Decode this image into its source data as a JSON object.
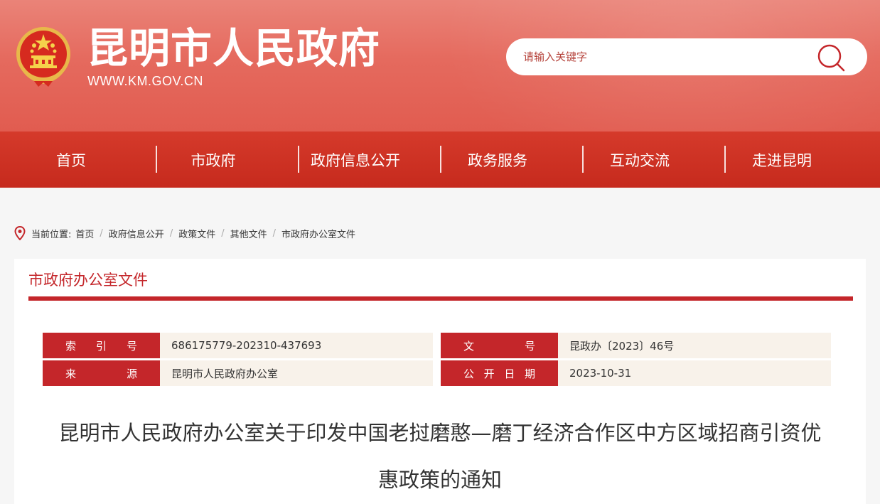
{
  "header": {
    "title": "昆明市人民政府",
    "url": "WWW.KM.GOV.CN",
    "search_placeholder": "请输入关键字"
  },
  "nav": {
    "items": [
      {
        "label": "首页"
      },
      {
        "label": "市政府"
      },
      {
        "label": "政府信息公开"
      },
      {
        "label": "政务服务"
      },
      {
        "label": "互动交流"
      },
      {
        "label": "走进昆明"
      }
    ]
  },
  "breadcrumb": {
    "prefix": "当前位置:",
    "items": [
      "首页",
      "政府信息公开",
      "政策文件",
      "其他文件",
      "市政府办公室文件"
    ]
  },
  "panel": {
    "title": "市政府办公室文件"
  },
  "meta": {
    "index_label": [
      "索",
      "引",
      "号"
    ],
    "index_value": "686175779-202310-437693",
    "docno_label": [
      "文",
      "号"
    ],
    "docno_value": "昆政办〔2023〕46号",
    "source_label": [
      "来",
      "源"
    ],
    "source_value": "昆明市人民政府办公室",
    "date_label": [
      "公",
      "开",
      "日",
      "期"
    ],
    "date_value": "2023-10-31"
  },
  "document": {
    "title_line1": "昆明市人民政府办公室关于印发中国老挝磨憨—磨丁经济合作区中方区域招商引资优",
    "title_line2": "惠政策的通知"
  },
  "colors": {
    "header_top": "#ea8378",
    "nav_red": "#c62a1d",
    "accent_red": "#c4262a",
    "meta_bg": "#f8f2ea"
  }
}
